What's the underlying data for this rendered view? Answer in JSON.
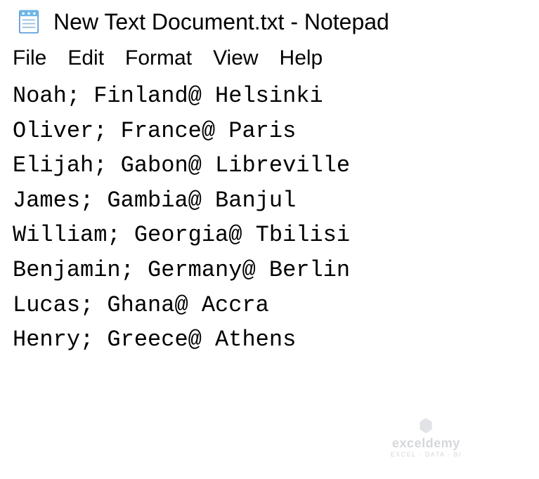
{
  "window": {
    "title": "New Text Document.txt - Notepad"
  },
  "menu": {
    "items": [
      "File",
      "Edit",
      "Format",
      "View",
      "Help"
    ]
  },
  "content": {
    "lines": [
      "Noah; Finland@ Helsinki",
      "Oliver; France@ Paris",
      "Elijah; Gabon@ Libreville",
      "James; Gambia@ Banjul",
      "William; Georgia@ Tbilisi",
      "Benjamin; Germany@ Berlin",
      "Lucas; Ghana@ Accra",
      "Henry; Greece@ Athens"
    ]
  },
  "watermark": {
    "title": "exceldemy",
    "subtitle": "EXCEL · DATA · BI"
  }
}
